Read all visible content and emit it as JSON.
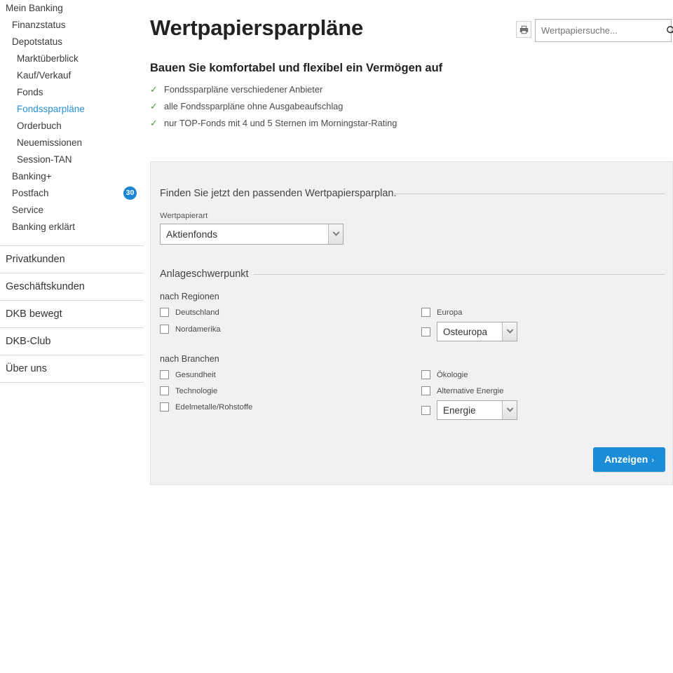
{
  "sidebar": {
    "nav": [
      {
        "label": "Mein Banking",
        "level": 1,
        "active": false,
        "badge": null
      },
      {
        "label": "Finanzstatus",
        "level": 2,
        "active": false,
        "badge": null
      },
      {
        "label": "Depotstatus",
        "level": 2,
        "active": false,
        "badge": null
      },
      {
        "label": "Marktüberblick",
        "level": 3,
        "active": false,
        "badge": null
      },
      {
        "label": "Kauf/Verkauf",
        "level": 3,
        "active": false,
        "badge": null
      },
      {
        "label": "Fonds",
        "level": 3,
        "active": false,
        "badge": null
      },
      {
        "label": "Fondssparpläne",
        "level": 3,
        "active": true,
        "badge": null
      },
      {
        "label": "Orderbuch",
        "level": 3,
        "active": false,
        "badge": null
      },
      {
        "label": "Neuemissionen",
        "level": 3,
        "active": false,
        "badge": null
      },
      {
        "label": "Session-TAN",
        "level": 3,
        "active": false,
        "badge": null
      },
      {
        "label": "Banking+",
        "level": 2,
        "active": false,
        "badge": null
      },
      {
        "label": "Postfach",
        "level": 2,
        "active": false,
        "badge": "30"
      },
      {
        "label": "Service",
        "level": 2,
        "active": false,
        "badge": null
      },
      {
        "label": "Banking erklärt",
        "level": 2,
        "active": false,
        "badge": null
      }
    ],
    "sections": [
      {
        "label": "Privatkunden"
      },
      {
        "label": "Geschäftskunden"
      },
      {
        "label": "DKB bewegt"
      },
      {
        "label": "DKB-Club"
      },
      {
        "label": "Über uns"
      }
    ]
  },
  "header": {
    "title": "Wertpapiersparpläne",
    "print_icon": "printer-icon",
    "search": {
      "placeholder": "Wertpapiersuche...",
      "value": "",
      "icon": "search-icon"
    }
  },
  "intro": {
    "subtitle": "Bauen Sie komfortabel und flexibel ein Vermögen auf",
    "check_mark": "✓",
    "bullets": [
      "Fondssparpläne verschiedener Anbieter",
      "alle Fondssparpläne ohne Ausgabeaufschlag",
      "nur TOP-Fonds mit 4 und 5 Sternen im Morningstar-Rating"
    ]
  },
  "panel": {
    "heading": "Finden Sie jetzt den passenden Wertpapiersparplan.",
    "wertpapierart": {
      "label": "Wertpapierart",
      "selected": "Aktienfonds",
      "options": [
        "Aktienfonds"
      ]
    },
    "anlageschwerpunkt": {
      "heading": "Anlageschwerpunkt",
      "regionen": {
        "label": "nach Regionen",
        "left": [
          {
            "label": "Deutschland",
            "checked": false
          },
          {
            "label": "Nordamerika",
            "checked": false
          }
        ],
        "right": [
          {
            "label": "Europa",
            "checked": false
          }
        ],
        "right_select": {
          "checked": false,
          "selected": "Osteuropa",
          "options": [
            "Osteuropa"
          ]
        }
      },
      "branchen": {
        "label": "nach Branchen",
        "left": [
          {
            "label": "Gesundheit",
            "checked": false
          },
          {
            "label": "Technologie",
            "checked": false
          },
          {
            "label": "Edelmetalle/Rohstoffe",
            "checked": false
          }
        ],
        "right": [
          {
            "label": "Ökologie",
            "checked": false
          },
          {
            "label": "Alternative Energie",
            "checked": false
          }
        ],
        "right_select": {
          "checked": false,
          "selected": "Energie",
          "options": [
            "Energie"
          ]
        }
      }
    },
    "submit": {
      "label": "Anzeigen",
      "caret": "›"
    }
  },
  "colors": {
    "accent_blue": "#1b8cd8",
    "link_blue": "#2a8fd4",
    "badge_blue": "#1b87d4",
    "check_green": "#5a9c3e",
    "panel_bg": "#f1f1f1"
  }
}
